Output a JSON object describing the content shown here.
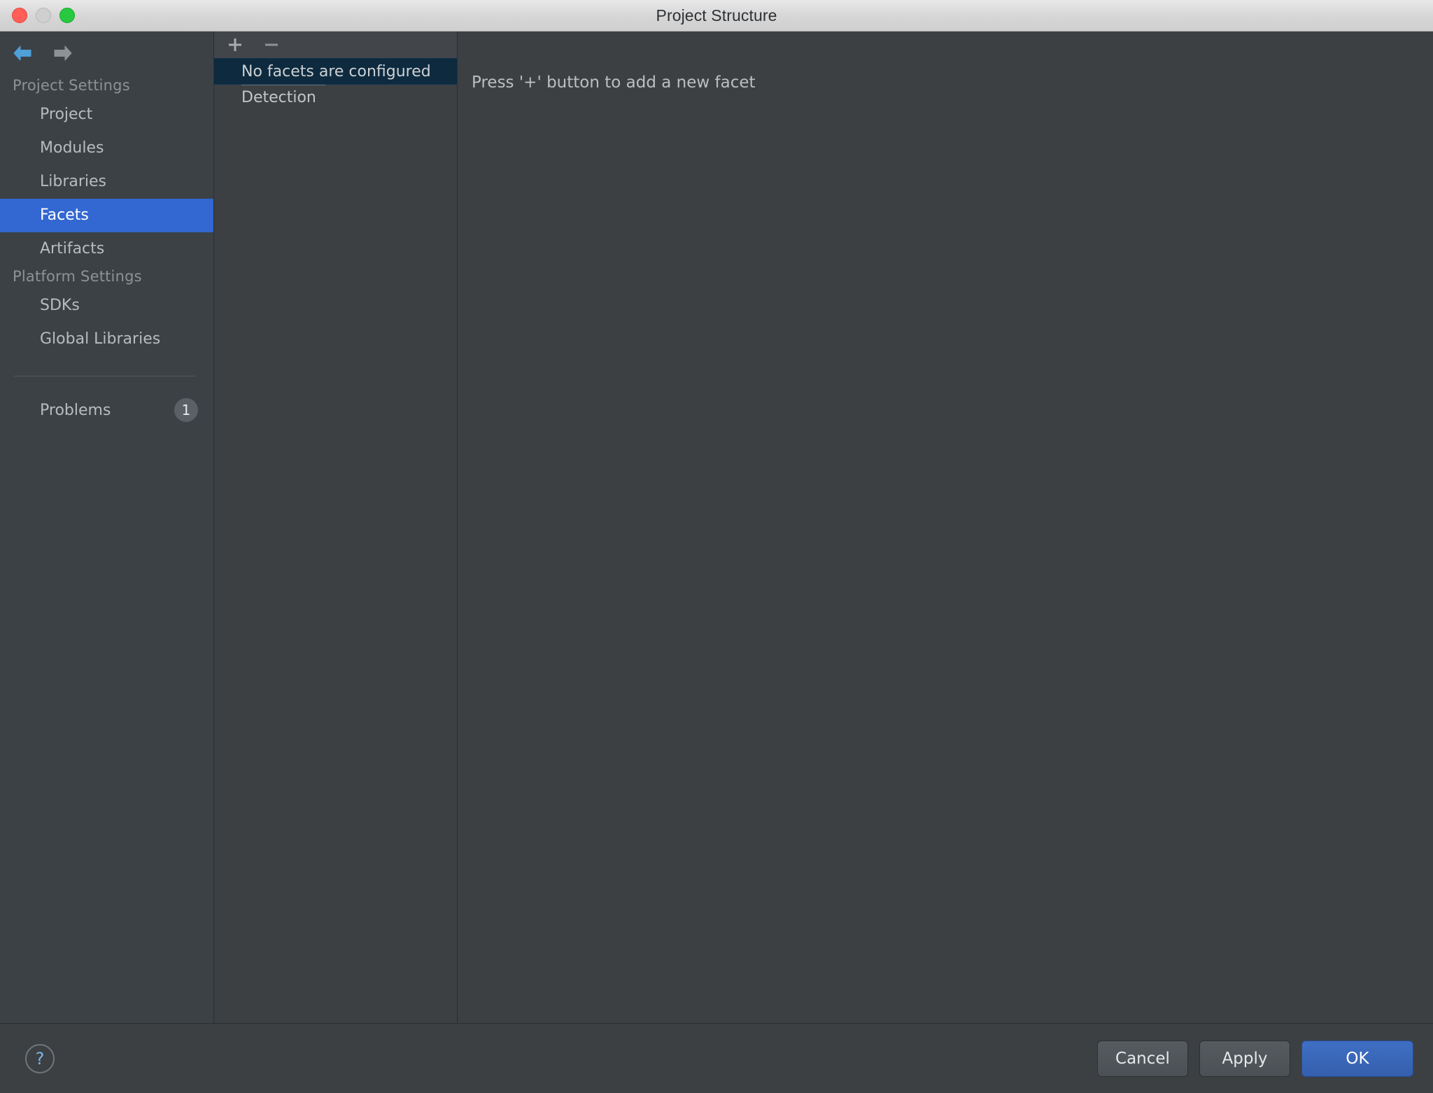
{
  "window": {
    "title": "Project Structure",
    "traffic_lights": [
      "close-red",
      "minimize-yellow",
      "zoom-green"
    ]
  },
  "navigation": {
    "back_icon": "back-arrow-icon",
    "forward_icon": "forward-arrow-icon"
  },
  "sidebar": {
    "groups": [
      {
        "title": "Project Settings",
        "items": [
          {
            "label": "Project",
            "selected": false
          },
          {
            "label": "Modules",
            "selected": false
          },
          {
            "label": "Libraries",
            "selected": false
          },
          {
            "label": "Facets",
            "selected": true
          },
          {
            "label": "Artifacts",
            "selected": false
          }
        ]
      },
      {
        "title": "Platform Settings",
        "items": [
          {
            "label": "SDKs",
            "selected": false
          },
          {
            "label": "Global Libraries",
            "selected": false
          }
        ]
      }
    ],
    "problems": {
      "label": "Problems",
      "count": "1"
    }
  },
  "list_panel": {
    "toolbar": {
      "add_label": "+",
      "add_icon": "plus-icon",
      "remove_label": "−",
      "remove_icon": "minus-icon"
    },
    "rows": [
      {
        "label": "No facets are configured",
        "selected": true
      },
      {
        "label": "Detection",
        "selected": false
      }
    ]
  },
  "detail": {
    "message": "Press '+' button to add a new facet"
  },
  "bottom_bar": {
    "help_label": "?",
    "buttons": [
      {
        "label": "Cancel",
        "primary": false
      },
      {
        "label": "Apply",
        "primary": false
      },
      {
        "label": "OK",
        "primary": true
      }
    ]
  },
  "colors": {
    "accent_selected": "#3367d1",
    "list_selected": "#0d2a3f",
    "window_bg": "#3c4043",
    "primary_button": "#3f6fc4"
  }
}
